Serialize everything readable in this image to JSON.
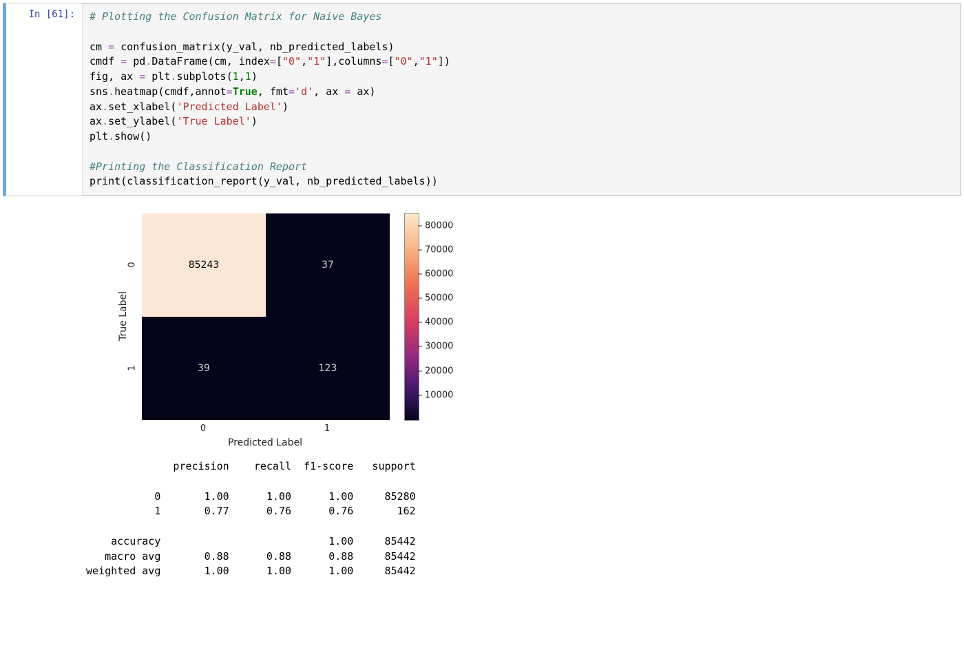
{
  "prompt": "In [61]:",
  "code": {
    "c1": "# Plotting the Confusion Matrix for Naive Bayes",
    "l2a": "cm ",
    "l2op": "=",
    "l2b": " confusion_matrix",
    "l2p1": "(",
    "l2c": "y_val",
    "l2comma1": ", ",
    "l2d": "nb_predicted_labels",
    "l2p2": ")",
    "l3a": "cmdf ",
    "l3op": "=",
    "l3b": " pd",
    "l3dot": ".",
    "l3c": "DataFrame",
    "l3p1": "(",
    "l3d": "cm",
    "l3comma1": ", ",
    "l3e": "index",
    "l3op2": "=",
    "l3br1": "[",
    "l3s1": "\"0\"",
    "l3comma2": ",",
    "l3s2": "\"1\"",
    "l3br2": "]",
    "l3comma3": ",",
    "l3f": "columns",
    "l3op3": "=",
    "l3br3": "[",
    "l3s3": "\"0\"",
    "l3comma4": ",",
    "l3s4": "\"1\"",
    "l3br4": "]",
    "l3p2": ")",
    "l4a": "fig",
    "l4comma": ", ",
    "l4b": "ax ",
    "l4op": "=",
    "l4c": " plt",
    "l4dot": ".",
    "l4d": "subplots",
    "l4p1": "(",
    "l4n1": "1",
    "l4comma2": ",",
    "l4n2": "1",
    "l4p2": ")",
    "l5a": "sns",
    "l5dot": ".",
    "l5b": "heatmap",
    "l5p1": "(",
    "l5c": "cmdf",
    "l5comma1": ",",
    "l5d": "annot",
    "l5op": "=",
    "l5kw": "True",
    "l5comma2": ", ",
    "l5e": "fmt",
    "l5op2": "=",
    "l5s": "'d'",
    "l5comma3": ", ",
    "l5f": "ax ",
    "l5op3": "=",
    "l5g": " ax",
    "l5p2": ")",
    "l6a": "ax",
    "l6dot": ".",
    "l6b": "set_xlabel",
    "l6p1": "(",
    "l6s": "'Predicted Label'",
    "l6p2": ")",
    "l7a": "ax",
    "l7dot": ".",
    "l7b": "set_ylabel",
    "l7p1": "(",
    "l7s": "'True Label'",
    "l7p2": ")",
    "l8a": "plt",
    "l8dot": ".",
    "l8b": "show",
    "l8p1": "(",
    "l8p2": ")",
    "c2": "#Printing the Classification Report",
    "l10a": "print",
    "l10p1": "(",
    "l10b": "classification_report",
    "l10p2": "(",
    "l10c": "y_val",
    "l10comma": ", ",
    "l10d": "nb_predicted_labels",
    "l10p3": ")",
    "l10p4": ")"
  },
  "chart_data": {
    "type": "heatmap",
    "xlabel": "Predicted Label",
    "ylabel": "True Label",
    "x_categories": [
      "0",
      "1"
    ],
    "y_categories": [
      "0",
      "1"
    ],
    "values": [
      [
        85243,
        37
      ],
      [
        39,
        123
      ]
    ],
    "annotations": {
      "r0c0": "85243",
      "r0c1": "37",
      "r1c0": "39",
      "r1c1": "123"
    },
    "colorbar_ticks": [
      {
        "label": "80000",
        "frac": 0.062
      },
      {
        "label": "70000",
        "frac": 0.18
      },
      {
        "label": "60000",
        "frac": 0.297
      },
      {
        "label": "50000",
        "frac": 0.414
      },
      {
        "label": "40000",
        "frac": 0.531
      },
      {
        "label": "30000",
        "frac": 0.648
      },
      {
        "label": "20000",
        "frac": 0.766
      },
      {
        "label": "10000",
        "frac": 0.883
      }
    ]
  },
  "report": "              precision    recall  f1-score   support\n\n           0       1.00      1.00      1.00     85280\n           1       0.77      0.76      0.76       162\n\n    accuracy                           1.00     85442\n   macro avg       0.88      0.88      0.88     85442\nweighted avg       1.00      1.00      1.00     85442"
}
